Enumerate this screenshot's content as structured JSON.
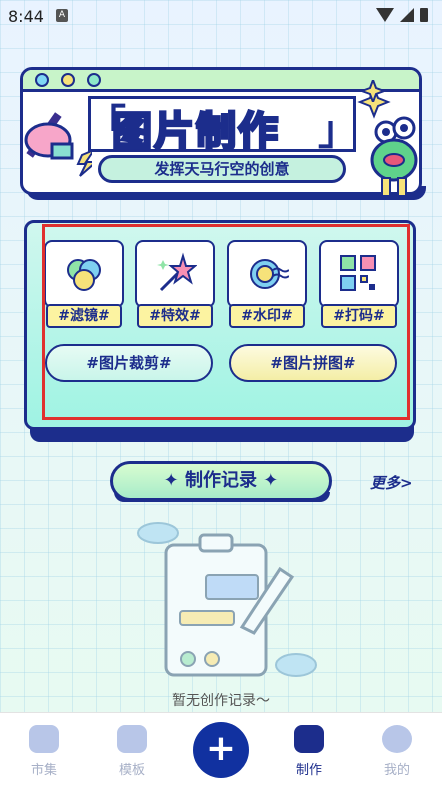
{
  "status_bar": {
    "time": "8:44",
    "app_badge": "A"
  },
  "banner": {
    "title": "图片制作",
    "bracket_open": "「",
    "bracket_close": "」",
    "subtitle": "发挥天马行空的创意"
  },
  "tools": [
    {
      "label": "#滤镜#",
      "icon": "filter-icon"
    },
    {
      "label": "#特效#",
      "icon": "magic-wand-icon"
    },
    {
      "label": "#水印#",
      "icon": "watermark-icon"
    },
    {
      "label": "#打码#",
      "icon": "mosaic-icon"
    }
  ],
  "wide_buttons": {
    "crop": "#图片裁剪#",
    "collage": "#图片拼图#"
  },
  "records": {
    "header": "制作记录",
    "more": "更多>",
    "empty": "暂无创作记录～"
  },
  "bottom_nav": {
    "items": [
      {
        "label": "市集",
        "icon": "home-icon"
      },
      {
        "label": "模板",
        "icon": "template-icon"
      },
      {
        "label": "制作",
        "icon": "edit-icon"
      },
      {
        "label": "我的",
        "icon": "profile-icon"
      }
    ],
    "plus": "+",
    "active": "制作"
  },
  "colors": {
    "navy": "#1c2d8c",
    "highlight": "#e0302e",
    "label_yellow": "#fcf3a1"
  }
}
